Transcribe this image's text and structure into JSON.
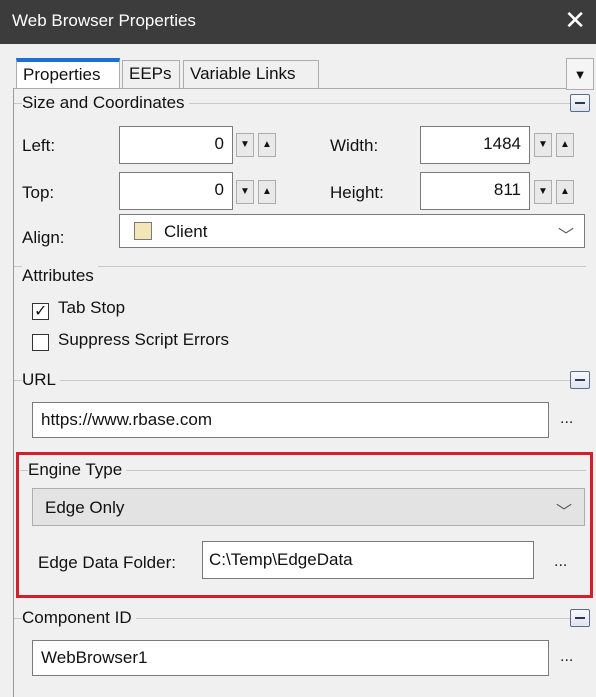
{
  "window": {
    "title": "Web Browser Properties",
    "close_glyph": "✕"
  },
  "tabs": [
    {
      "label": "Properties",
      "active": true
    },
    {
      "label": "EEPs",
      "active": false
    },
    {
      "label": "Variable Links",
      "active": false
    }
  ],
  "tab_dropdown_glyph": "▼",
  "size": {
    "title": "Size and Coordinates",
    "left_label": "Left:",
    "left_value": "0",
    "top_label": "Top:",
    "top_value": "0",
    "width_label": "Width:",
    "width_value": "1484",
    "height_label": "Height:",
    "height_value": "811",
    "align_label": "Align:",
    "align_value": "Client",
    "swatch_color": "#f5e6b8"
  },
  "attributes": {
    "title": "Attributes",
    "tab_stop_label": "Tab Stop",
    "tab_stop_checked": true,
    "suppress_label": "Suppress Script Errors",
    "suppress_checked": false
  },
  "url": {
    "title": "URL",
    "value": "https://www.rbase.com",
    "button": "..."
  },
  "engine": {
    "title": "Engine Type",
    "value": "Edge Only",
    "folder_label": "Edge Data Folder:",
    "folder_value": "C:\\Temp\\EdgeData",
    "button": "...",
    "highlight_color": "#d41e2c"
  },
  "component": {
    "title": "Component ID",
    "value": "WebBrowser1",
    "button": "..."
  },
  "icons": {
    "spin_down": "▼",
    "spin_up": "▲",
    "chevron": "﹀"
  }
}
